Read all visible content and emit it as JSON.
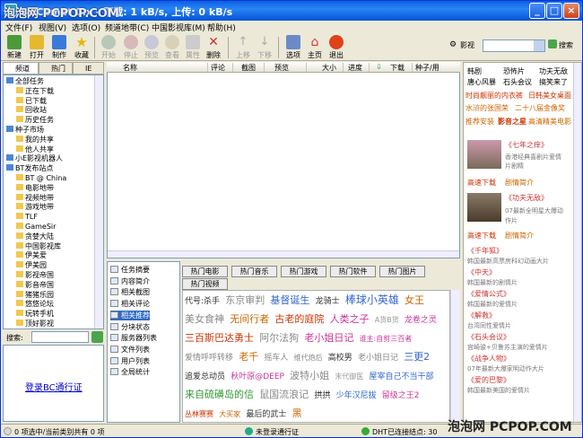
{
  "window": {
    "title": "BitComet 0.x - 下载: 1 kB/s, 上传: 0 kB/s"
  },
  "watermarks": {
    "top": "泡泡网 PCPOP.COM",
    "bottom": "泡泡网 PCPOP.COM"
  },
  "menu": [
    "文件(F)",
    "视图(V)",
    "选项(O)",
    "频道地带(C)",
    "中国影视库(M)",
    "帮助(H)"
  ],
  "toolbar": {
    "buttons": [
      {
        "label": "新建",
        "icon": "new-icon"
      },
      {
        "label": "打开",
        "icon": "open-icon"
      },
      {
        "label": "制作",
        "icon": "make-icon"
      },
      {
        "label": "收藏",
        "icon": "star-icon"
      },
      {
        "label": "开始",
        "icon": "start-icon"
      },
      {
        "label": "停止",
        "icon": "stop-icon"
      },
      {
        "label": "预览",
        "icon": "preview-icon"
      },
      {
        "label": "查看",
        "icon": "view-icon"
      },
      {
        "label": "属性",
        "icon": "properties-icon"
      },
      {
        "label": "删除",
        "icon": "delete-icon"
      },
      {
        "label": "上移",
        "icon": "up-icon"
      },
      {
        "label": "下移",
        "icon": "down-icon"
      },
      {
        "label": "选项",
        "icon": "options-icon"
      },
      {
        "label": "主页",
        "icon": "home-icon"
      },
      {
        "label": "退出",
        "icon": "exit-icon"
      }
    ],
    "search_label": "影视",
    "search_button": "搜索"
  },
  "left_tabs": [
    "频道",
    "热门",
    "IE"
  ],
  "tree": [
    {
      "label": "全部任务",
      "level": 0
    },
    {
      "label": "正在下载",
      "level": 1
    },
    {
      "label": "已下载",
      "level": 1
    },
    {
      "label": "回收站",
      "level": 1
    },
    {
      "label": "历史任务",
      "level": 1
    },
    {
      "label": "种子市场",
      "level": 0
    },
    {
      "label": "我的共享",
      "level": 1
    },
    {
      "label": "他人共享",
      "level": 1
    },
    {
      "label": "小E影视机器人",
      "level": 0
    },
    {
      "label": "BT发布站点",
      "level": 0
    },
    {
      "label": "BT @ China",
      "level": 1
    },
    {
      "label": "电影地带",
      "level": 1
    },
    {
      "label": "视频地带",
      "level": 1
    },
    {
      "label": "游戏地带",
      "level": 1
    },
    {
      "label": "TLF",
      "level": 1
    },
    {
      "label": "GameSir",
      "level": 1
    },
    {
      "label": "贪婪大陆",
      "level": 1
    },
    {
      "label": "中国影视库",
      "level": 1
    },
    {
      "label": "伊美爱",
      "level": 1
    },
    {
      "label": "伊美园",
      "level": 1
    },
    {
      "label": "影视帝国",
      "level": 1
    },
    {
      "label": "影音帝国",
      "level": 1
    },
    {
      "label": "猪猪乐园",
      "level": 1
    },
    {
      "label": "悠悠论坛",
      "level": 1
    },
    {
      "label": "玩转手机",
      "level": 1
    },
    {
      "label": "顶好影视",
      "level": 1
    }
  ],
  "left_search": {
    "label": "搜索:"
  },
  "login_link": "登录BC通行证",
  "list_columns": [
    "名称",
    "评论",
    "截图",
    "预览",
    "大小",
    "进度",
    "下载",
    "种子/用"
  ],
  "detail_nav": [
    {
      "label": "任务摘要",
      "selected": false
    },
    {
      "label": "内容简介",
      "selected": false
    },
    {
      "label": "相关截图",
      "selected": false
    },
    {
      "label": "相关评论",
      "selected": false
    },
    {
      "label": "相关推荐",
      "selected": true
    },
    {
      "label": "分块状态",
      "selected": false
    },
    {
      "label": "服务器列表",
      "selected": false
    },
    {
      "label": "文件列表",
      "selected": false
    },
    {
      "label": "用户列表",
      "selected": false
    },
    {
      "label": "全局统计",
      "selected": false
    }
  ],
  "hot_tabs": [
    {
      "label": "热门电影",
      "active": true
    },
    {
      "label": "热门音乐",
      "active": false
    },
    {
      "label": "热门游戏",
      "active": false
    },
    {
      "label": "热门软件",
      "active": false
    },
    {
      "label": "热门图片",
      "active": false
    },
    {
      "label": "热门视频",
      "active": false
    }
  ],
  "hot_cloud": [
    {
      "text": "代号:杀手",
      "color": "#333333",
      "size": 9
    },
    {
      "text": "东京审判",
      "color": "#888888",
      "size": 11
    },
    {
      "text": "基督诞生",
      "color": "#3366cc",
      "size": 11
    },
    {
      "text": "龙骑士",
      "color": "#333333",
      "size": 9
    },
    {
      "text": "棒球小英雄",
      "color": "#3366cc",
      "size": 12
    },
    {
      "text": "女王",
      "color": "#cc6600",
      "size": 11
    },
    {
      "text": "美女食神",
      "color": "#888888",
      "size": 11
    },
    {
      "text": "无间行者",
      "color": "#cc6600",
      "size": 11
    },
    {
      "text": "古老的庭院",
      "color": "#cc3300",
      "size": 11
    },
    {
      "text": "人类之子",
      "color": "#cc3399",
      "size": 11
    },
    {
      "text": "A货B货",
      "color": "#999999",
      "size": 8
    },
    {
      "text": "龙卷之灵",
      "color": "#cc3399",
      "size": 9
    },
    {
      "text": "三百斯巴达勇士",
      "color": "#cc3300",
      "size": 11
    },
    {
      "text": "阿尔法狗",
      "color": "#888888",
      "size": 11
    },
    {
      "text": "老小姐日记",
      "color": "#cc3399",
      "size": 11
    },
    {
      "text": "谁主:自剪三百者",
      "color": "#cc3399",
      "size": 8
    },
    {
      "text": "爱情呼呼转移",
      "color": "#888888",
      "size": 9
    },
    {
      "text": "老千",
      "color": "#cc6600",
      "size": 11
    },
    {
      "text": "摇车人",
      "color": "#888888",
      "size": 9
    },
    {
      "text": "维代炮后",
      "color": "#888888",
      "size": 8
    },
    {
      "text": "高校男",
      "color": "#333333",
      "size": 9
    },
    {
      "text": "老小姐日记",
      "color": "#888888",
      "size": 9
    },
    {
      "text": "三更2",
      "color": "#3366cc",
      "size": 11
    },
    {
      "text": "追爱总动员",
      "color": "#333333",
      "size": 9
    },
    {
      "text": "秋叶原@DEEP",
      "color": "#cc3399",
      "size": 9
    },
    {
      "text": "波特小姐",
      "color": "#888888",
      "size": 11
    },
    {
      "text": "末代御医",
      "color": "#999999",
      "size": 8
    },
    {
      "text": "屋宰自己不当干部",
      "color": "#3366cc",
      "size": 9
    },
    {
      "text": "来自硫磺岛的信",
      "color": "#339933",
      "size": 11
    },
    {
      "text": "鼠国流浪记",
      "color": "#888888",
      "size": 11
    },
    {
      "text": "拱拱",
      "color": "#333333",
      "size": 9
    },
    {
      "text": "少年汉尼拔",
      "color": "#3366cc",
      "size": 9
    },
    {
      "text": "留级之王2",
      "color": "#cc3399",
      "size": 9
    },
    {
      "text": "丛林赛赛",
      "color": "#cc3300",
      "size": 8
    },
    {
      "text": "大买家",
      "color": "#cc6600",
      "size": 8
    },
    {
      "text": "最后的武士",
      "color": "#333333",
      "size": 9
    },
    {
      "text": "黑",
      "color": "#cc6600",
      "size": 11
    }
  ],
  "right_panel": {
    "links": [
      [
        "韩剧",
        "恐怖片",
        "功夫无敌"
      ],
      [
        "唐心风暴",
        "石头会议",
        "搞笑来了"
      ]
    ],
    "promo": [
      {
        "text": "时尚靓丽的内衣裤",
        "color": "#cc3300"
      },
      {
        "text": "日韩美女桌面",
        "color": "#cc3300"
      },
      {
        "text": "水浒的张国荣",
        "color": "#cc6600"
      },
      {
        "text": "二十八届金像奖",
        "color": "#cc6600"
      },
      {
        "text": "推荐安装",
        "color": "#cc6600"
      },
      {
        "text": "影音之星",
        "color": "#cc3300"
      },
      {
        "text": "高清精美电影",
        "color": "#cc6600"
      }
    ],
    "features": [
      {
        "title": "《七年之痒》",
        "desc": [
          "香港经典喜剧片爱情",
          "片剧精"
        ],
        "more": "高速下载",
        "detail": "剧情简介"
      },
      {
        "title": "《功夫无敌》",
        "desc": [
          "07最新全明星大爆动",
          "作片"
        ],
        "more": "高速下载",
        "detail": "剧情简介"
      }
    ],
    "list": [
      {
        "title": "《千年狐》",
        "desc": "韩国最新高票房科幻动画大片"
      },
      {
        "title": "《中天》",
        "desc": "韩国最新的剧情片"
      },
      {
        "title": "《爱情公式》",
        "desc": "韩国最新的爱情片"
      },
      {
        "title": "《解救》",
        "desc": "台湾同性爱情片"
      },
      {
        "title": "《石头会议》",
        "desc": "宫崎骏+贝鲁苏主演的爱情片"
      },
      {
        "title": "《战争人物》",
        "desc": "07年最新大爆家明动作大片"
      },
      {
        "title": "《爱的巴黎》",
        "desc": "韩国最新美国的爱情片"
      }
    ]
  },
  "status": {
    "left": "0 项选中/当前类别共有 0 项",
    "center": "未登录通行证",
    "right": "DHT已连接结点: 30"
  }
}
